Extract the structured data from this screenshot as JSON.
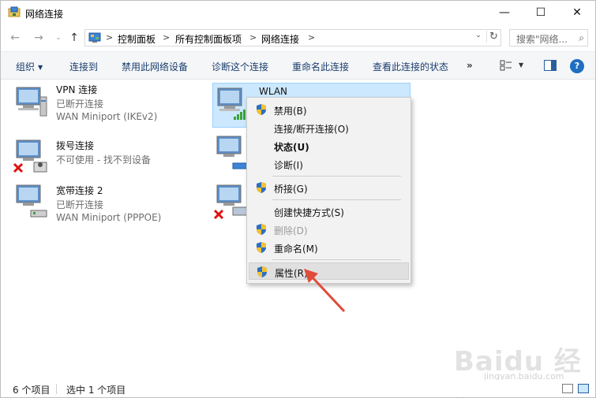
{
  "window": {
    "title": "网络连接"
  },
  "window_controls": {
    "minimize": "—",
    "maximize": "☐",
    "close": "✕"
  },
  "nav": {
    "back": "←",
    "forward": "→",
    "recent": "⌄",
    "up": "↑"
  },
  "breadcrumb": {
    "items": [
      "控制面板",
      "所有控制面板项",
      "网络连接"
    ],
    "separator": ">"
  },
  "search": {
    "placeholder": "搜索\"网络..."
  },
  "commands": {
    "organize": "组织",
    "connect_to": "连接到",
    "disable": "禁用此网络设备",
    "diagnose": "诊断这个连接",
    "rename": "重命名此连接",
    "view_status": "查看此连接的状态",
    "more": "»"
  },
  "help": "?",
  "connections": [
    {
      "name": "VPN 连接",
      "status": "已断开连接",
      "device": "WAN Miniport (IKEv2)"
    },
    {
      "name": "WLAN",
      "status": "",
      "device": ""
    },
    {
      "name": "拨号连接",
      "status": "不可使用 - 找不到设备",
      "device": ""
    },
    {
      "name": "宽带连接 2",
      "status": "已断开连接",
      "device": "WAN Miniport (PPPOE)"
    }
  ],
  "context_menu": {
    "items": [
      {
        "label": "禁用(B)",
        "shield": true,
        "bold": false,
        "disabled": false
      },
      {
        "label": "连接/断开连接(O)",
        "shield": false,
        "bold": false,
        "disabled": false
      },
      {
        "label": "状态(U)",
        "shield": false,
        "bold": true,
        "disabled": false
      },
      {
        "label": "诊断(I)",
        "shield": false,
        "bold": false,
        "disabled": false
      },
      {
        "label": "桥接(G)",
        "shield": true,
        "bold": false,
        "disabled": false
      },
      {
        "label": "创建快捷方式(S)",
        "shield": false,
        "bold": false,
        "disabled": false
      },
      {
        "label": "删除(D)",
        "shield": true,
        "bold": false,
        "disabled": true
      },
      {
        "label": "重命名(M)",
        "shield": true,
        "bold": false,
        "disabled": false
      },
      {
        "label": "属性(R)",
        "shield": true,
        "bold": false,
        "disabled": false,
        "hovered": true
      }
    ]
  },
  "statusbar": {
    "count": "6 个项目",
    "selected": "选中 1 个项目"
  },
  "watermark": {
    "text": "Baidu 经验",
    "url": "jingyan.baidu.com"
  },
  "colors": {
    "selection": "#cce8ff",
    "accent": "#1f6fc2",
    "arrow": "#e04b3a"
  }
}
